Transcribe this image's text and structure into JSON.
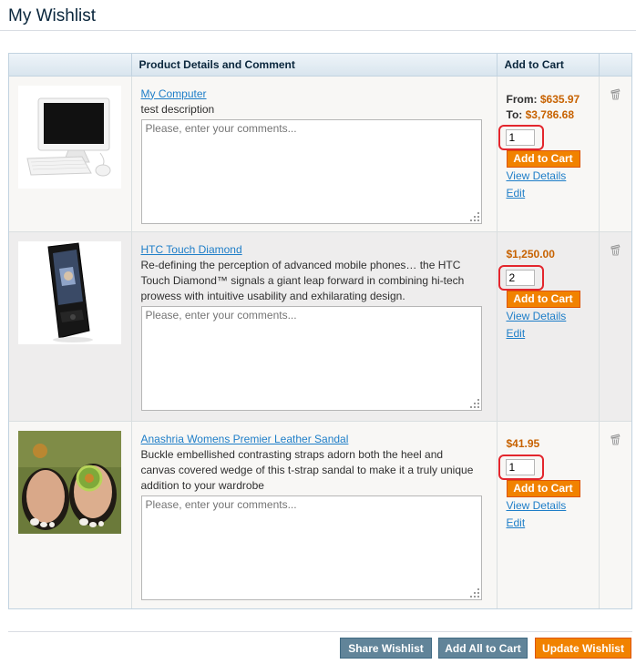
{
  "page": {
    "title": "My Wishlist"
  },
  "table": {
    "headers": {
      "image": "",
      "details": "Product Details and Comment",
      "cart": "Add to Cart",
      "remove": ""
    },
    "items": [
      {
        "name": "My Computer",
        "description": "test description",
        "comment_placeholder": "Please, enter your comments...",
        "price_from_label": "From:",
        "price_from": "$635.97",
        "price_to_label": "To:",
        "price_to": "$3,786.68",
        "qty": "1",
        "add_to_cart": "Add to Cart",
        "view_details": "View Details",
        "edit": "Edit"
      },
      {
        "name": "HTC Touch Diamond",
        "description_lines": [
          "Re-defining the perception of advanced mobile phones… the HTC",
          "Touch Diamond™ signals a giant leap forward in combining hi-tech",
          "prowess with intuitive usability and exhilarating design."
        ],
        "comment_placeholder": "Please, enter your comments...",
        "price": "$1,250.00",
        "qty": "2",
        "add_to_cart": "Add to Cart",
        "view_details": "View Details",
        "edit": "Edit"
      },
      {
        "name": "Anashria Womens Premier Leather Sandal",
        "description_lines": [
          "Buckle embellished contrasting straps adorn both the heel and",
          "canvas covered wedge of this t-strap sandal to make it a truly unique",
          "addition to your wardrobe"
        ],
        "comment_placeholder": "Please, enter your comments...",
        "price": "$41.95",
        "qty": "1",
        "add_to_cart": "Add to Cart",
        "view_details": "View Details",
        "edit": "Edit"
      }
    ]
  },
  "footer": {
    "share": "Share Wishlist",
    "add_all": "Add All to Cart",
    "update": "Update Wishlist"
  },
  "colors": {
    "price": "#c76200",
    "link": "#1e7ec8",
    "cart_button": "#f18200",
    "gray_button": "#618499",
    "highlight_ring": "#e3262d"
  }
}
